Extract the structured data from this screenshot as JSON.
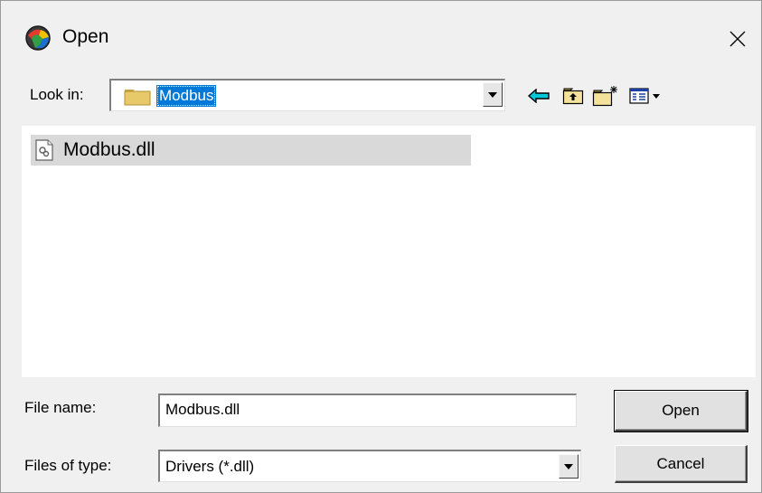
{
  "window": {
    "title": "Open",
    "close_glyph": "✕",
    "app_icon": "app-globe-icon"
  },
  "lookin": {
    "label": "Look in:",
    "value": "Modbus"
  },
  "toolbar": {
    "icons": [
      "back-arrow-icon",
      "up-folder-icon",
      "new-folder-icon",
      "view-menu-icon"
    ],
    "colors": {
      "back_arrow": "#00c8d8",
      "folder": "#e8c96a"
    }
  },
  "files": [
    {
      "name": "Modbus.dll",
      "selected": true
    }
  ],
  "filename": {
    "label": "File name:",
    "value": "Modbus.dll"
  },
  "filetype": {
    "label": "Files of type:",
    "value": "Drivers (*.dll)"
  },
  "buttons": {
    "open": "Open",
    "cancel": "Cancel"
  },
  "colors": {
    "dialog_bg": "#f0f0f0",
    "selection": "#0078d7",
    "file_selected_bg": "#d9d9d9"
  }
}
